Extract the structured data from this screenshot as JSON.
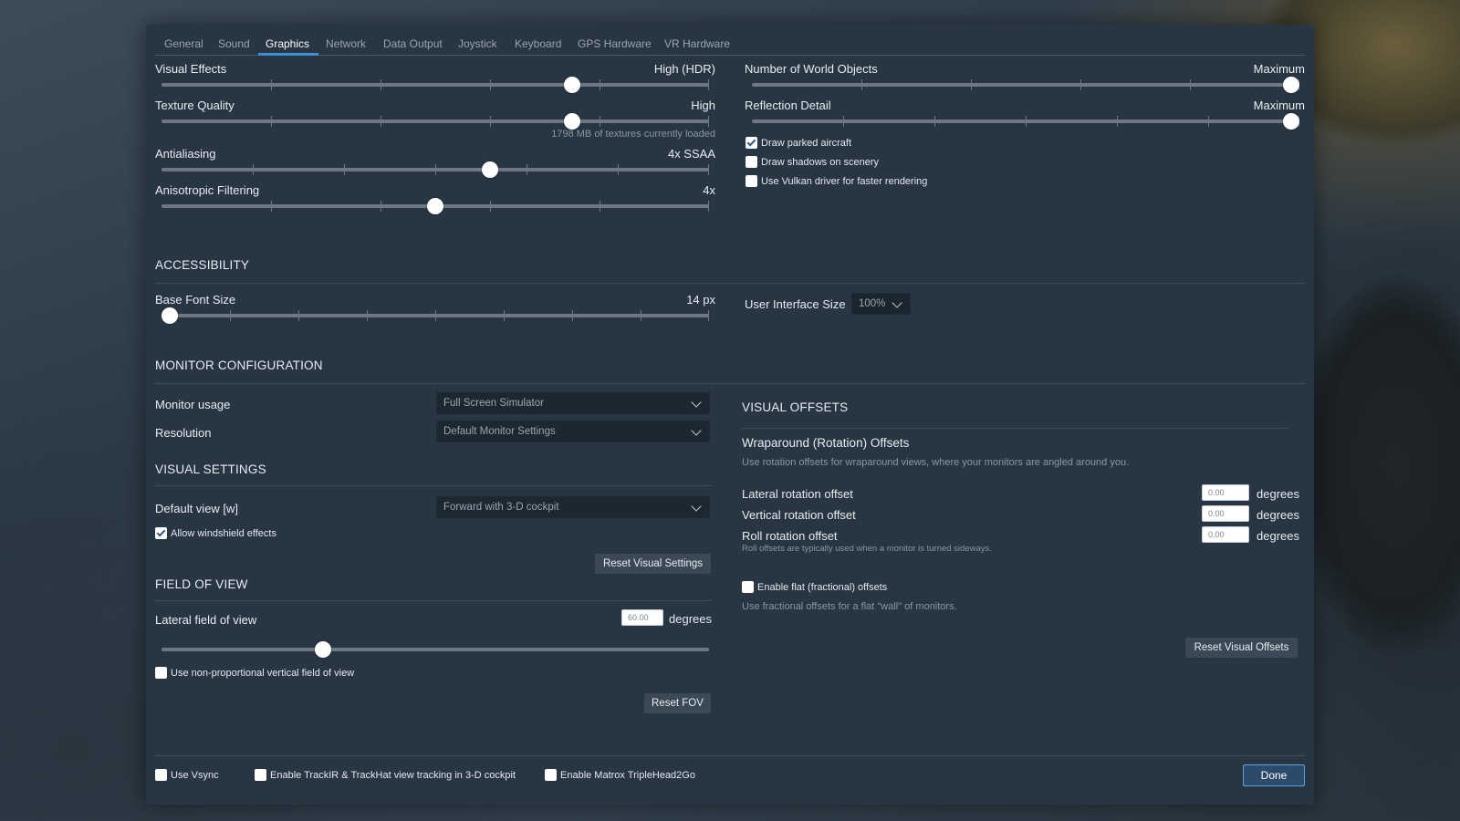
{
  "tabs": [
    "General",
    "Sound",
    "Graphics",
    "Network",
    "Data Output",
    "Joystick",
    "Keyboard",
    "GPS Hardware",
    "VR Hardware"
  ],
  "active_tab": "Graphics",
  "graphics": {
    "visual_effects": {
      "label": "Visual Effects",
      "value": "High (HDR)",
      "position": 0.75
    },
    "texture_quality": {
      "label": "Texture Quality",
      "value": "High",
      "position": 0.75,
      "note": "1798 MB of textures currently loaded"
    },
    "antialiasing": {
      "label": "Antialiasing",
      "value": "4x SSAA",
      "position": 0.6
    },
    "anisotropic": {
      "label": "Anisotropic Filtering",
      "value": "4x",
      "position": 0.5
    },
    "world_objects": {
      "label": "Number of World Objects",
      "value": "Maximum",
      "position": 1.0
    },
    "reflection": {
      "label": "Reflection Detail",
      "value": "Maximum",
      "position": 1.0
    },
    "draw_parked_aircraft": {
      "label": "Draw parked aircraft",
      "checked": true
    },
    "draw_shadows": {
      "label": "Draw shadows on scenery",
      "checked": false
    },
    "use_vulkan": {
      "label": "Use Vulkan driver for faster rendering",
      "checked": false
    }
  },
  "accessibility": {
    "title": "ACCESSIBILITY",
    "base_font": {
      "label": "Base Font Size",
      "value": "14 px",
      "position": 0.0
    },
    "ui_size": {
      "label": "User Interface Size",
      "value": "100%"
    }
  },
  "monitor": {
    "title": "MONITOR CONFIGURATION",
    "usage": {
      "label": "Monitor usage",
      "value": "Full Screen Simulator"
    },
    "resolution": {
      "label": "Resolution",
      "value": "Default Monitor Settings"
    }
  },
  "visual_settings": {
    "title": "VISUAL SETTINGS",
    "default_view": {
      "label": "Default view [w]",
      "value": "Forward with 3-D cockpit"
    },
    "windshield": {
      "label": "Allow windshield effects",
      "checked": true
    },
    "reset_label": "Reset Visual Settings"
  },
  "fov": {
    "title": "FIELD OF VIEW",
    "lateral": {
      "label": "Lateral field of view",
      "value": "60.00",
      "unit": "degrees",
      "position": 0.295
    },
    "non_proportional": {
      "label": "Use non-proportional vertical field of view",
      "checked": false
    },
    "reset_label": "Reset FOV"
  },
  "visual_offsets": {
    "title": "VISUAL OFFSETS",
    "wraparound_title": "Wraparound (Rotation) Offsets",
    "wraparound_desc": "Use rotation offsets for wraparound views, where your monitors are angled around you.",
    "lateral": {
      "label": "Lateral rotation offset",
      "value": "0.00",
      "unit": "degrees"
    },
    "vertical": {
      "label": "Vertical rotation offset",
      "value": "0.00",
      "unit": "degrees"
    },
    "roll": {
      "label": "Roll rotation offset",
      "value": "0.00",
      "unit": "degrees",
      "note": "Roll offsets are typically used when a monitor is turned sideways."
    },
    "flat": {
      "label": "Enable flat (fractional) offsets",
      "checked": false,
      "desc": "Use fractional offsets for a flat \"wall\" of monitors."
    },
    "reset_label": "Reset Visual Offsets"
  },
  "footer": {
    "vsync": {
      "label": "Use Vsync",
      "checked": false
    },
    "trackir": {
      "label": "Enable TrackIR & TrackHat view tracking in 3-D cockpit",
      "checked": false
    },
    "matrox": {
      "label": "Enable Matrox TripleHead2Go",
      "checked": false
    },
    "done_label": "Done"
  },
  "colors": {
    "panel": "#283543",
    "accent": "#3e8fd6",
    "track": "#6d7883"
  }
}
